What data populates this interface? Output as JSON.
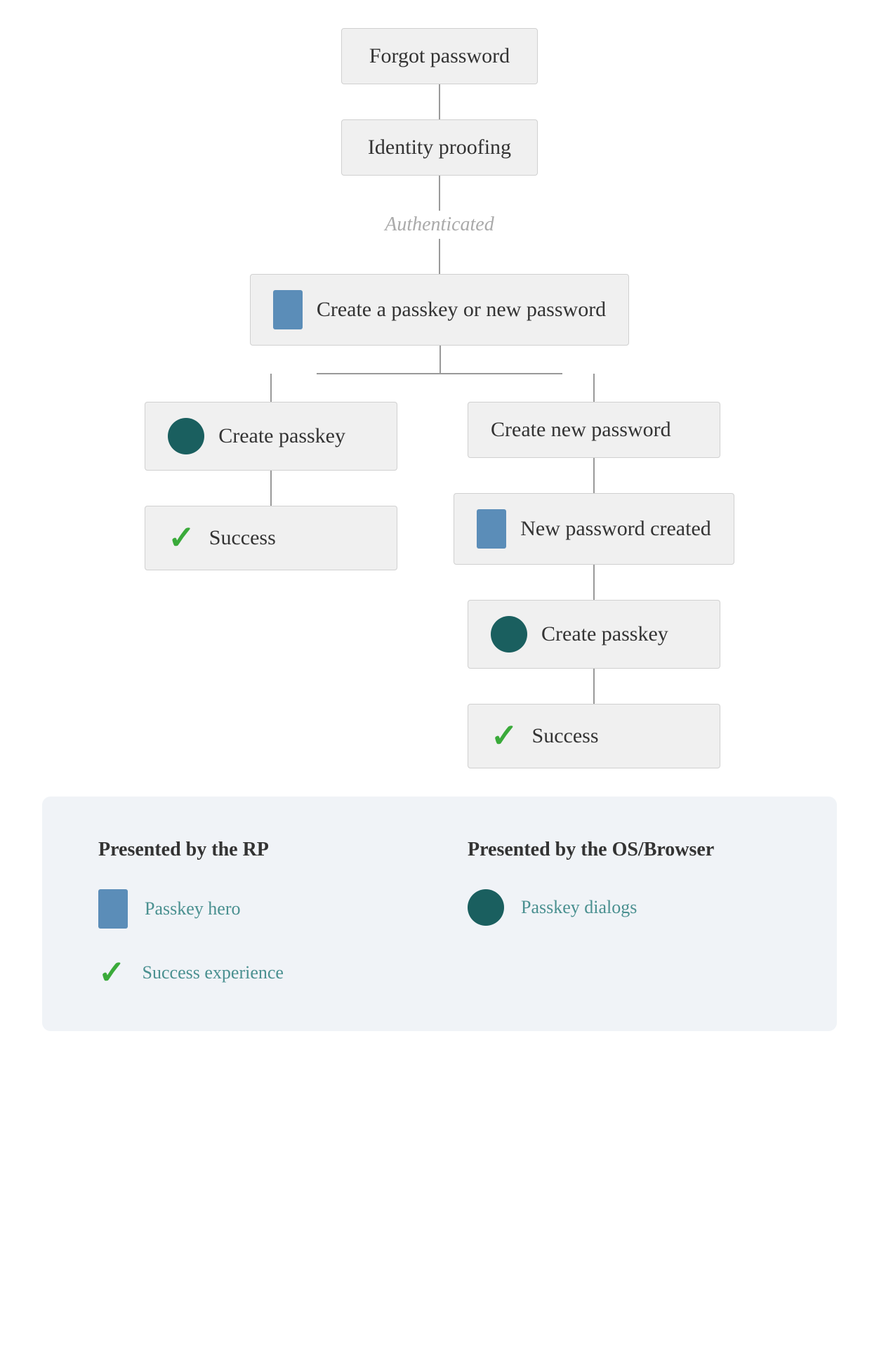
{
  "nodes": {
    "forgot_password": "Forgot password",
    "identity_proofing": "Identity proofing",
    "authenticated_label": "Authenticated",
    "create_passkey_or_password": "Create a passkey or new password",
    "left_branch": {
      "create_passkey": "Create passkey",
      "success": "Success"
    },
    "right_branch": {
      "create_new_password": "Create new password",
      "new_password_created": "New password created",
      "create_passkey": "Create passkey",
      "success": "Success"
    }
  },
  "legend": {
    "rp_title": "Presented by the RP",
    "browser_title": "Presented by the OS/Browser",
    "items_rp": [
      {
        "label": "Passkey hero",
        "icon": "rect"
      },
      {
        "label": "Success experience",
        "icon": "check"
      }
    ],
    "items_browser": [
      {
        "label": "Passkey dialogs",
        "icon": "circle"
      }
    ]
  }
}
